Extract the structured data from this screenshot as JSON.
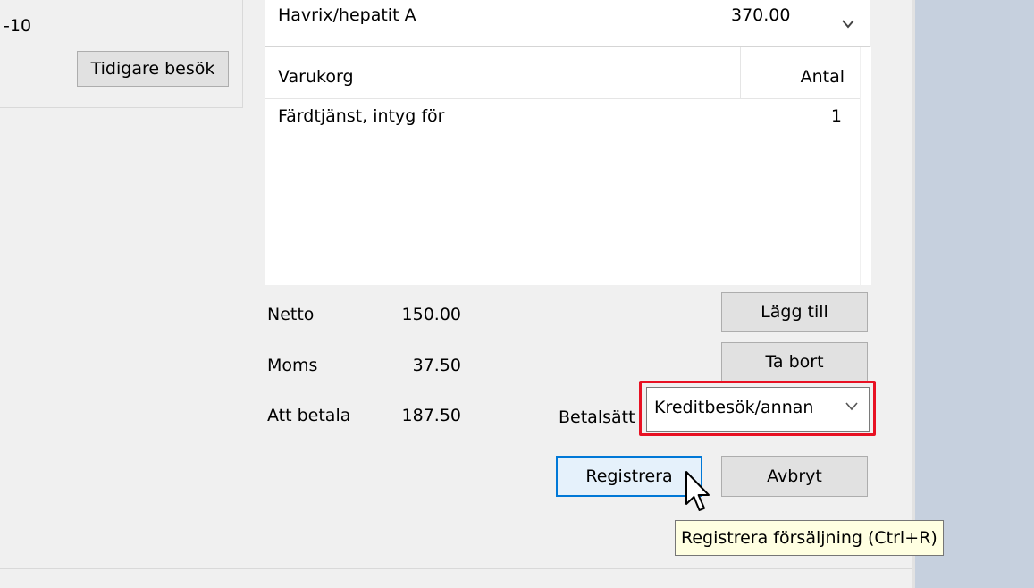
{
  "left_panel": {
    "prefix_text": "-10",
    "prev_visits_label": "Tidigare besök"
  },
  "service_combo": {
    "name": "Havrix/hepatit A",
    "price": "370.00",
    "cut_text": "... . . . . . ..",
    "chevron": "chevron-down-icon"
  },
  "basket": {
    "header_name": "Varukorg",
    "header_qty": "Antal",
    "rows": [
      {
        "name": "Färdtjänst, intyg för",
        "qty": "1"
      }
    ]
  },
  "totals": {
    "netto_label": "Netto",
    "netto_value": "150.00",
    "moms_label": "Moms",
    "moms_value": "37.50",
    "att_betala_label": "Att betala",
    "att_betala_value": "187.50"
  },
  "actions": {
    "add_label": "Lägg till",
    "remove_label": "Ta bort",
    "register_label": "Registrera",
    "cancel_label": "Avbryt"
  },
  "payment": {
    "label": "Betalsätt",
    "selected": "Kreditbesök/annan",
    "chevron": "chevron-down-icon"
  },
  "tooltip": {
    "text": "Registrera försäljning (Ctrl+R)"
  },
  "colors": {
    "highlight": "#e81123",
    "focus": "#0078d7",
    "desktop": "#c6d0de"
  }
}
